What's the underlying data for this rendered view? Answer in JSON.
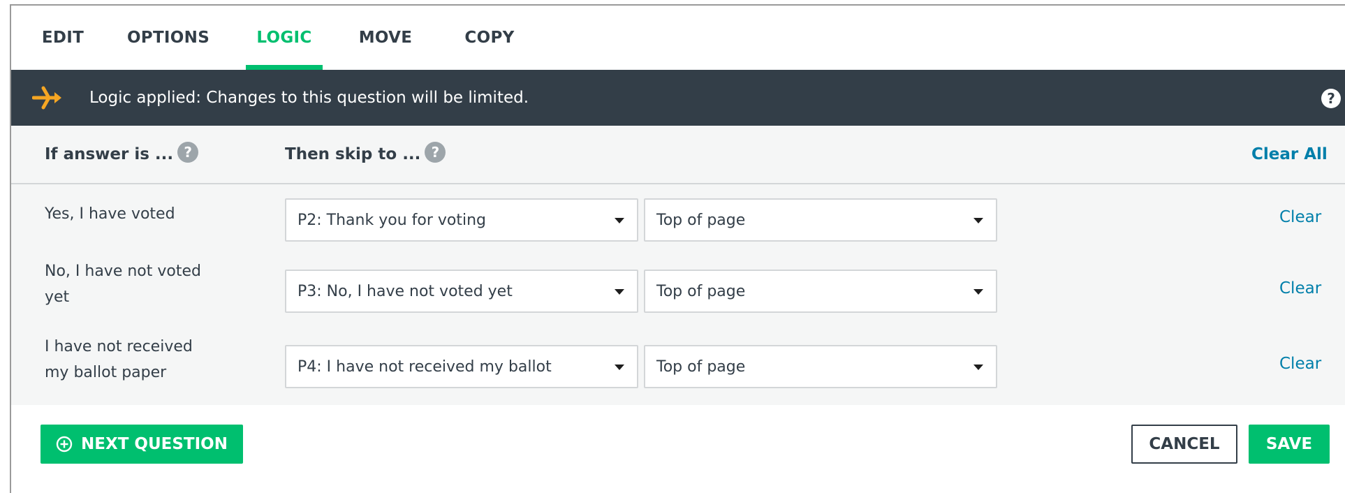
{
  "tabs": [
    {
      "label": "EDIT"
    },
    {
      "label": "OPTIONS"
    },
    {
      "label": "LOGIC"
    },
    {
      "label": "MOVE"
    },
    {
      "label": "COPY"
    }
  ],
  "active_tab": "LOGIC",
  "banner": {
    "text": "Logic applied: Changes to this question will be limited.",
    "help": "?",
    "icon": "logic-branch-icon"
  },
  "table": {
    "answer_header": "If answer is ...",
    "skip_header": "Then skip to ...",
    "help": "?",
    "clear_all": "Clear All",
    "rows": [
      {
        "answer": "Yes, I have voted",
        "page": "P2: Thank you for voting",
        "position": "Top of page",
        "clear": "Clear"
      },
      {
        "answer": "No, I have not voted yet",
        "page": "P3: No, I have not voted yet",
        "position": "Top of page",
        "clear": "Clear"
      },
      {
        "answer": "I have not received my ballot paper",
        "page": "P4: I have not received my ballot",
        "position": "Top of page",
        "clear": "Clear"
      }
    ]
  },
  "footer": {
    "next_question": "NEXT QUESTION",
    "cancel": "CANCEL",
    "save": "SAVE"
  },
  "colors": {
    "accent": "#00bf6f",
    "banner_bg": "#333e48",
    "link": "#007faa"
  }
}
